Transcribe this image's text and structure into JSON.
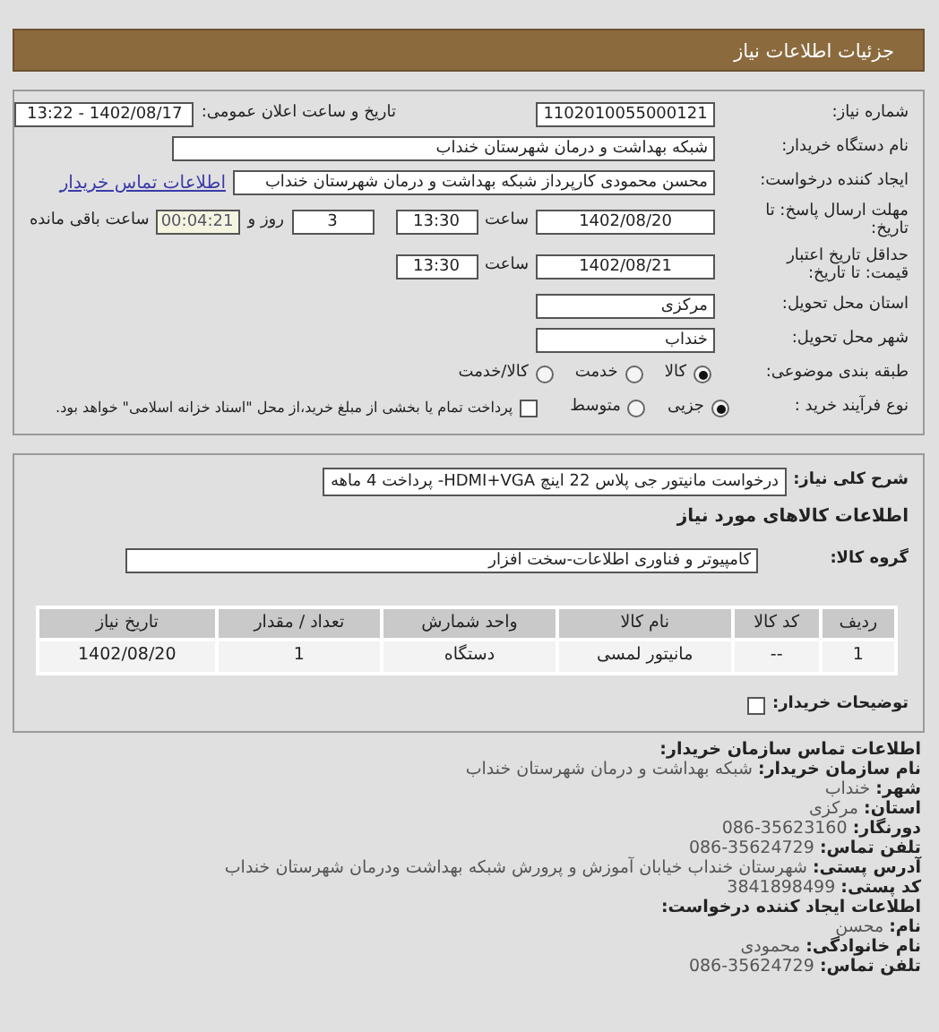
{
  "header": {
    "title": "جزئیات اطلاعات نیاز"
  },
  "need_number": {
    "label": "شماره نیاز:",
    "value": "1102010055000121"
  },
  "announce": {
    "label": "تاریخ و ساعت اعلان عمومی:",
    "value": "1402/08/17 - 13:22"
  },
  "buyer": {
    "label": "نام دستگاه خریدار:",
    "value": "شبکه بهداشت و درمان شهرستان خنداب"
  },
  "creator": {
    "label": "ایجاد کننده درخواست:",
    "value": "محسن محمودی کارپرداز شبکه بهداشت و درمان شهرستان خنداب",
    "link": "اطلاعات تماس خریدار"
  },
  "reply_deadline": {
    "label": "مهلت ارسال پاسخ: تا تاریخ:",
    "date": "1402/08/20",
    "time_label": "ساعت",
    "time": "13:30",
    "days": "3",
    "days_label": "روز و",
    "remaining": "00:04:21",
    "remaining_label": "ساعت باقی مانده"
  },
  "price_validity": {
    "label": "حداقل تاریخ اعتبار قیمت: تا تاریخ:",
    "date": "1402/08/21",
    "time_label": "ساعت",
    "time": "13:30"
  },
  "province": {
    "label": "استان محل تحویل:",
    "value": "مرکزی"
  },
  "city": {
    "label": "شهر محل تحویل:",
    "value": "خنداب"
  },
  "category": {
    "label": "طبقه بندی موضوعی:",
    "options": [
      {
        "label": "کالا",
        "selected": true
      },
      {
        "label": "خدمت",
        "selected": false
      },
      {
        "label": "کالا/خدمت",
        "selected": false
      }
    ]
  },
  "purchase_type": {
    "label": "نوع فرآیند خرید :",
    "options": [
      {
        "label": "جزیی",
        "selected": true
      },
      {
        "label": "متوسط",
        "selected": false
      }
    ],
    "treasury": {
      "label": "پرداخت تمام یا بخشی از مبلغ خرید،از محل \"اسناد خزانه اسلامی\" خواهد بود.",
      "checked": false
    }
  },
  "description": {
    "label": "شرح کلی نیاز:",
    "value": "درخواست مانیتور جی پلاس 22 اینچ HDMI+VGA- پرداخت 4 ماهه"
  },
  "goods_heading": "اطلاعات کالاهای مورد نیاز",
  "goods_group": {
    "label": "گروه کالا:",
    "value": "کامپیوتر و فناوری اطلاعات-سخت افزار"
  },
  "table": {
    "columns": [
      "ردیف",
      "کد کالا",
      "نام کالا",
      "واحد شمارش",
      "تعداد / مقدار",
      "تاریخ نیاز"
    ],
    "rows": [
      [
        "1",
        "--",
        "مانیتور لمسی",
        "دستگاه",
        "1",
        "1402/08/20"
      ]
    ]
  },
  "buyer_notes": {
    "label": "توضیحات خریدار:",
    "checked": false
  },
  "contact": {
    "heading": "اطلاعات تماس سازمان خریدار:",
    "lines": [
      {
        "label": "نام سازمان خریدار:",
        "value": "شبکه بهداشت و درمان شهرستان خنداب"
      },
      {
        "label": "شهر:",
        "value": "خنداب"
      },
      {
        "label": "استان:",
        "value": "مرکزی"
      },
      {
        "label": "دورنگار:",
        "value": "35623160-086"
      },
      {
        "label": "تلفن تماس:",
        "value": "35624729-086"
      },
      {
        "label": "آدرس پستی:",
        "value": "شهرستان خنداب خیابان آموزش و پرورش شبکه بهداشت ودرمان شهرستان خنداب"
      },
      {
        "label": "کد پستی:",
        "value": "3841898499"
      }
    ]
  },
  "creator_info": {
    "heading": "اطلاعات ایجاد کننده درخواست:",
    "lines": [
      {
        "label": "نام:",
        "value": "محسن"
      },
      {
        "label": "نام خانوادگی:",
        "value": "محمودی"
      },
      {
        "label": "تلفن تماس:",
        "value": "35624729-086"
      }
    ]
  }
}
